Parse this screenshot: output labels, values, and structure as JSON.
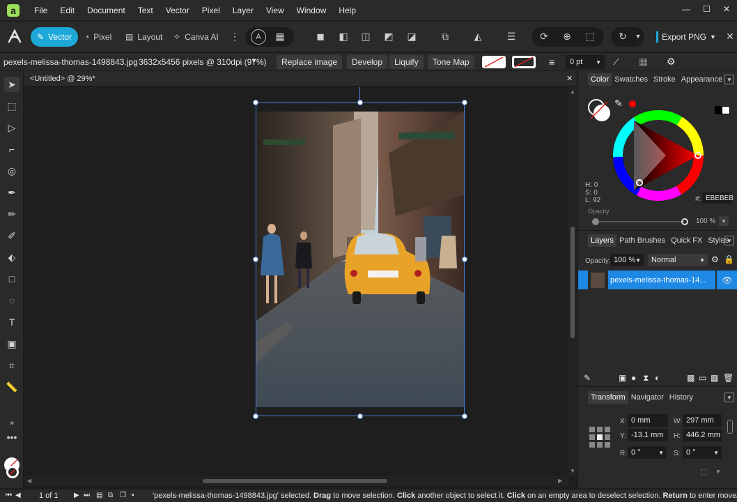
{
  "menubar": {
    "items": [
      "File",
      "Edit",
      "Document",
      "Text",
      "Vector",
      "Pixel",
      "Layer",
      "View",
      "Window",
      "Help"
    ],
    "window_controls": [
      "—",
      "☐",
      "✕"
    ]
  },
  "toolbar": {
    "personas": [
      {
        "label": "Vector",
        "icon": "vector-persona-icon"
      },
      {
        "label": "Pixel",
        "icon": "pixel-persona-icon"
      },
      {
        "label": "Layout",
        "icon": "layout-persona-icon"
      },
      {
        "label": "Canva AI",
        "icon": "canva-ai-icon"
      }
    ],
    "export_label": "Export PNG"
  },
  "context": {
    "filename": "pexels-melissa-thomas-1498843.jpg",
    "dimensions": "3632x5456 pixels @ 310dpi (97%)",
    "buttons": [
      "Replace image",
      "Develop",
      "Liquify",
      "Tone Map"
    ],
    "stroke_width": "0 pt"
  },
  "document": {
    "tab_title": "<Untitled> @ 29%*"
  },
  "color_panel": {
    "tabs": [
      "Color",
      "Swatches",
      "Stroke",
      "Appearance"
    ],
    "h": "H: 0",
    "s": "S: 0",
    "l": "L: 92",
    "hex_label": "#:",
    "hex_value": "EBEBEB",
    "opacity_label": "Opacity",
    "opacity_value": "100 %",
    "accent": "#ff0000"
  },
  "layers_panel": {
    "tabs": [
      "Layers",
      "Path Brushes",
      "Quick FX",
      "Styles"
    ],
    "opacity_label": "Opacity:",
    "opacity_value": "100 %",
    "blend_mode": "Normal",
    "layers": [
      {
        "name": "pexels-melissa-thomas-14...",
        "selected": true
      }
    ]
  },
  "transform_panel": {
    "tabs": [
      "Transform",
      "Navigator",
      "History"
    ],
    "x_label": "X:",
    "x_value": "0 mm",
    "y_label": "Y:",
    "y_value": "-13.1 mm",
    "w_label": "W:",
    "w_value": "297 mm",
    "h_label": "H:",
    "h_value": "446.2 mm",
    "r_label": "R:",
    "r_value": "0 °",
    "s_label": "S:",
    "s_value": "0 °"
  },
  "status": {
    "page": "1 of 1",
    "message_parts": [
      {
        "text": "'pexels-melissa-thomas-1498843.jpg' selected. ",
        "bold": false
      },
      {
        "text": "Drag",
        "bold": true
      },
      {
        "text": " to move selection. ",
        "bold": false
      },
      {
        "text": "Click",
        "bold": true
      },
      {
        "text": " another object to select it. ",
        "bold": false
      },
      {
        "text": "Click",
        "bold": true
      },
      {
        "text": " on an empty area to deselect selection. ",
        "bold": false
      },
      {
        "text": "Return",
        "bold": true
      },
      {
        "text": " to enter move/duplica",
        "bold": false
      }
    ]
  },
  "colors": {
    "accent": "#1da8d8",
    "selection": "#4a7fd1",
    "layer_highlight": "#1e88e5"
  }
}
